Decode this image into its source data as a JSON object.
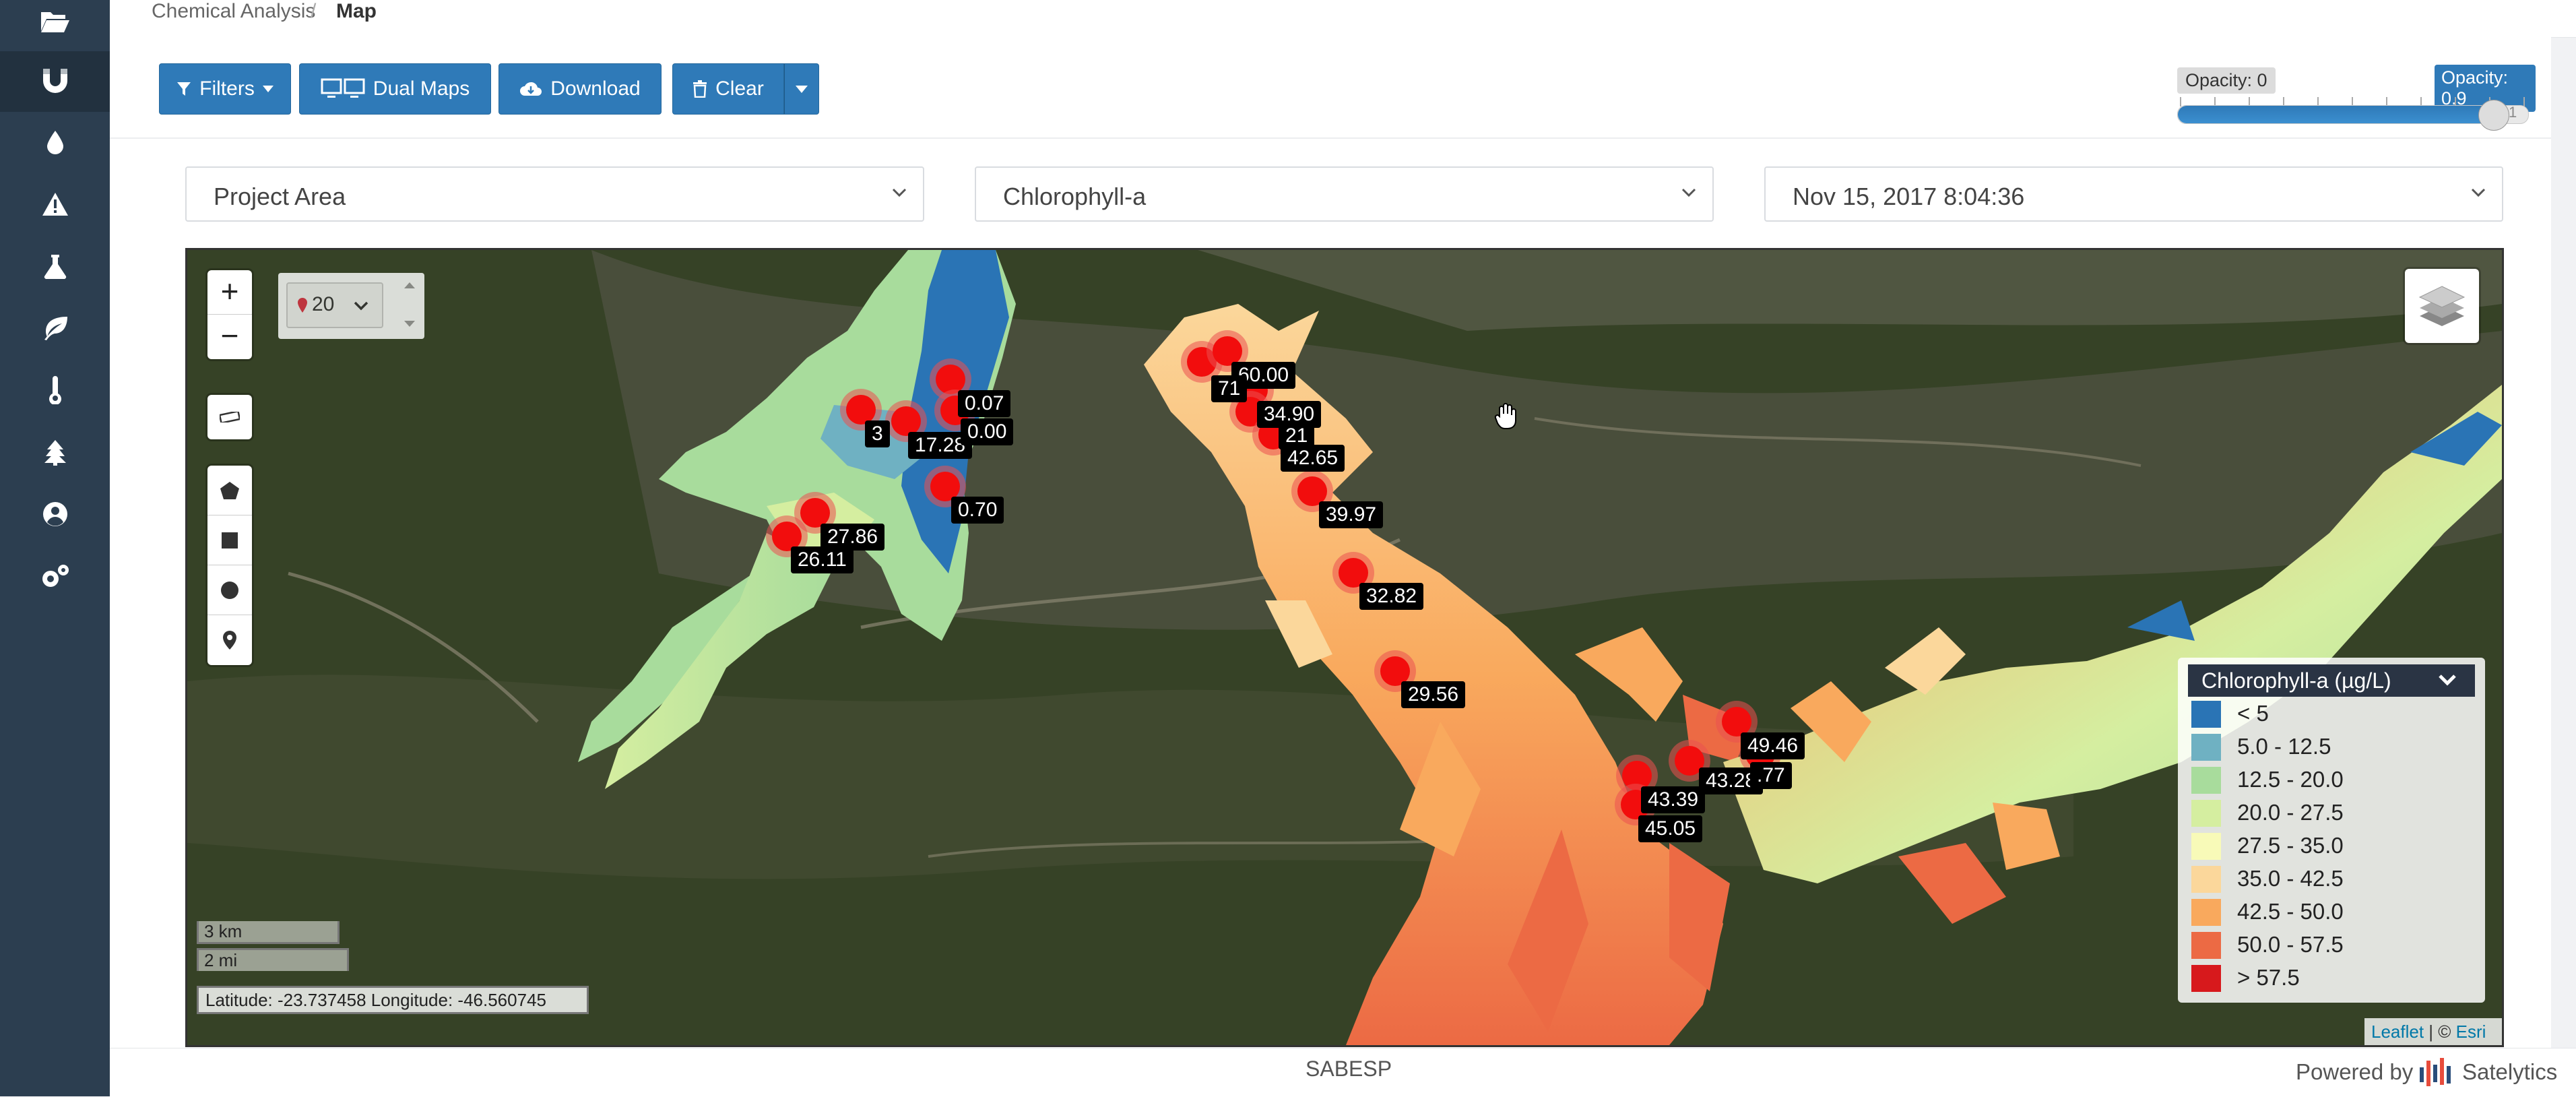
{
  "sidebar": {
    "items": [
      {
        "icon": "folder-open-icon"
      },
      {
        "icon": "magnet-icon",
        "active": true
      },
      {
        "icon": "water-drop-icon"
      },
      {
        "icon": "warning-icon"
      },
      {
        "icon": "flask-icon"
      },
      {
        "icon": "leaf-icon"
      },
      {
        "icon": "thermometer-icon"
      },
      {
        "icon": "tree-icon"
      },
      {
        "icon": "user-circle-icon"
      },
      {
        "icon": "gears-icon"
      }
    ]
  },
  "breadcrumb": {
    "parent": "Chemical Analysis",
    "separator": "/",
    "current": "Map"
  },
  "toolbar": {
    "filters_label": "Filters",
    "dual_maps_label": "Dual Maps",
    "download_label": "Download",
    "clear_label": "Clear",
    "opacity_min_label": "Opacity: 0",
    "opacity_value_label": "Opacity: 0.9",
    "opacity_value": 0.9,
    "slider_end_label": "1"
  },
  "selects": {
    "area": "Project Area",
    "parameter": "Chlorophyll-a",
    "date": "Nov 15, 2017 8:04:36"
  },
  "map": {
    "zoom_in": "+",
    "zoom_out": "−",
    "marker_count": "20",
    "scale_km": "3 km",
    "scale_mi": "2 mi",
    "coordinates": "Latitude: -23.737458 Longitude: -46.560745",
    "attribution_leaflet": "Leaflet",
    "attribution_sep": " | © ",
    "attribution_esri": "Esri",
    "value_labels": [
      "60.00",
      "71",
      "34.90",
      "21",
      "42.65",
      "39.97",
      "32.82",
      "29.56",
      "3",
      "17.28",
      "0.07",
      "0.00",
      "0.70",
      "27.86",
      "26.11",
      "49.46",
      "43.28",
      ".77",
      "43.39",
      "45.05"
    ]
  },
  "legend": {
    "title": "Chlorophyll-a (µg/L)",
    "items": [
      {
        "label": "< 5",
        "color": "#2a74b5"
      },
      {
        "label": "5.0 - 12.5",
        "color": "#6fb1c2"
      },
      {
        "label": "12.5 - 20.0",
        "color": "#a8dc9c"
      },
      {
        "label": "20.0 - 27.5",
        "color": "#d5eea0"
      },
      {
        "label": "27.5 - 35.0",
        "color": "#f8fab8"
      },
      {
        "label": "35.0 - 42.5",
        "color": "#fbd79b"
      },
      {
        "label": "42.5 - 50.0",
        "color": "#f9a95d"
      },
      {
        "label": "50.0 - 57.5",
        "color": "#ec6a44"
      },
      {
        "label": "> 57.5",
        "color": "#d7191c"
      }
    ]
  },
  "footer": {
    "center": "SABESP",
    "powered_by": "Powered by",
    "brand": "Satelytics"
  }
}
